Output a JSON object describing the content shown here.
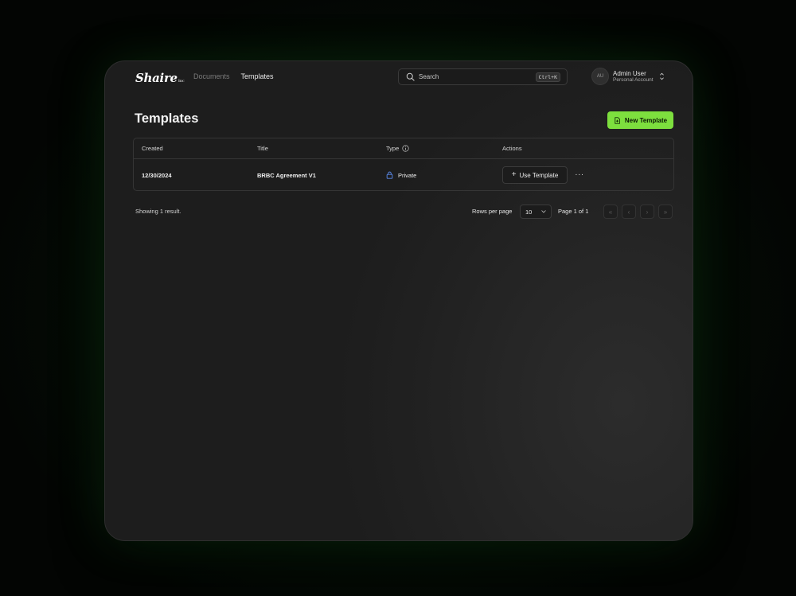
{
  "app": {
    "logo": "Shaire",
    "logo_sub": "inc"
  },
  "nav": {
    "documents": "Documents",
    "templates": "Templates"
  },
  "search": {
    "label": "Search",
    "shortcut": "Ctrl+K"
  },
  "account": {
    "initials": "AU",
    "name": "Admin User",
    "subtitle": "Personal Account"
  },
  "page": {
    "title": "Templates",
    "new_button": "New Template"
  },
  "table": {
    "headers": {
      "created": "Created",
      "title": "Title",
      "type": "Type",
      "actions": "Actions"
    },
    "rows": [
      {
        "created": "12/30/2024",
        "title": "BRBC Agreement V1",
        "type": "Private",
        "action_label": "Use Template",
        "more": "···"
      }
    ]
  },
  "footer": {
    "showing": "Showing 1 result.",
    "rows_per_page_label": "Rows per page",
    "rows_per_page_value": "10",
    "page_info": "Page 1 of 1",
    "first": "«",
    "prev": "‹",
    "next": "›",
    "last": "»"
  },
  "colors": {
    "accent": "#7ddf3e",
    "lock_icon": "#5b8cf0"
  }
}
